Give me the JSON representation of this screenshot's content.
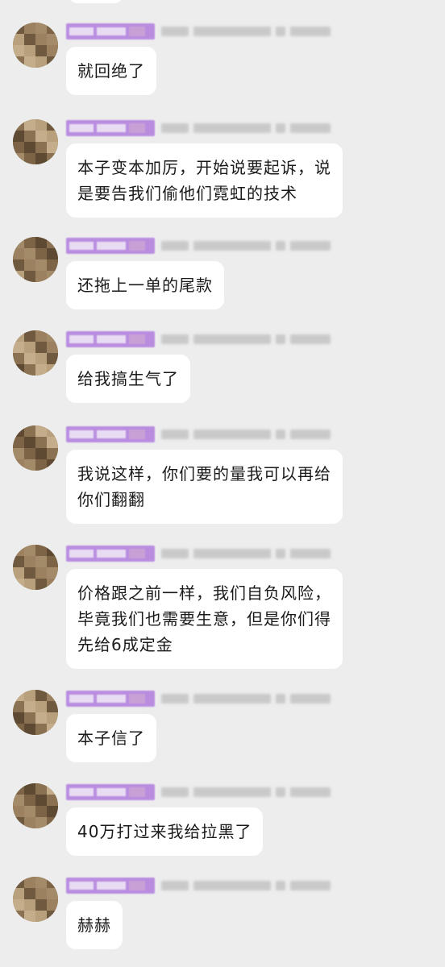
{
  "conversation": {
    "messages": [
      {
        "id": "m1",
        "lines": [
          "就回绝了"
        ]
      },
      {
        "id": "m2",
        "lines": [
          "本子变本加厉，开始说要起诉，说",
          "是要告我们偷他们霓虹的技术"
        ]
      },
      {
        "id": "m3",
        "lines": [
          "还拖上一单的尾款"
        ]
      },
      {
        "id": "m4",
        "lines": [
          "给我搞生气了"
        ]
      },
      {
        "id": "m5",
        "lines": [
          "我说这样，你们要的量我可以再给",
          "你们翻翻"
        ]
      },
      {
        "id": "m6",
        "lines": [
          "价格跟之前一样，我们自负风险，",
          "毕竟我们也需要生意，但是你们得",
          "先给6成定金"
        ]
      },
      {
        "id": "m7",
        "lines": [
          "本子信了"
        ]
      },
      {
        "id": "m8",
        "lines": [
          "40万打过来我给拉黑了"
        ]
      },
      {
        "id": "m9",
        "lines": [
          "赫赫"
        ]
      }
    ]
  },
  "colors": {
    "background": "#ededed",
    "bubble": "#ffffff",
    "badge": "#b98ce0",
    "text": "#1a1a1a"
  },
  "icons": {
    "avatar": "pixelated-avatar-icon",
    "badge": "member-badge-icon"
  }
}
